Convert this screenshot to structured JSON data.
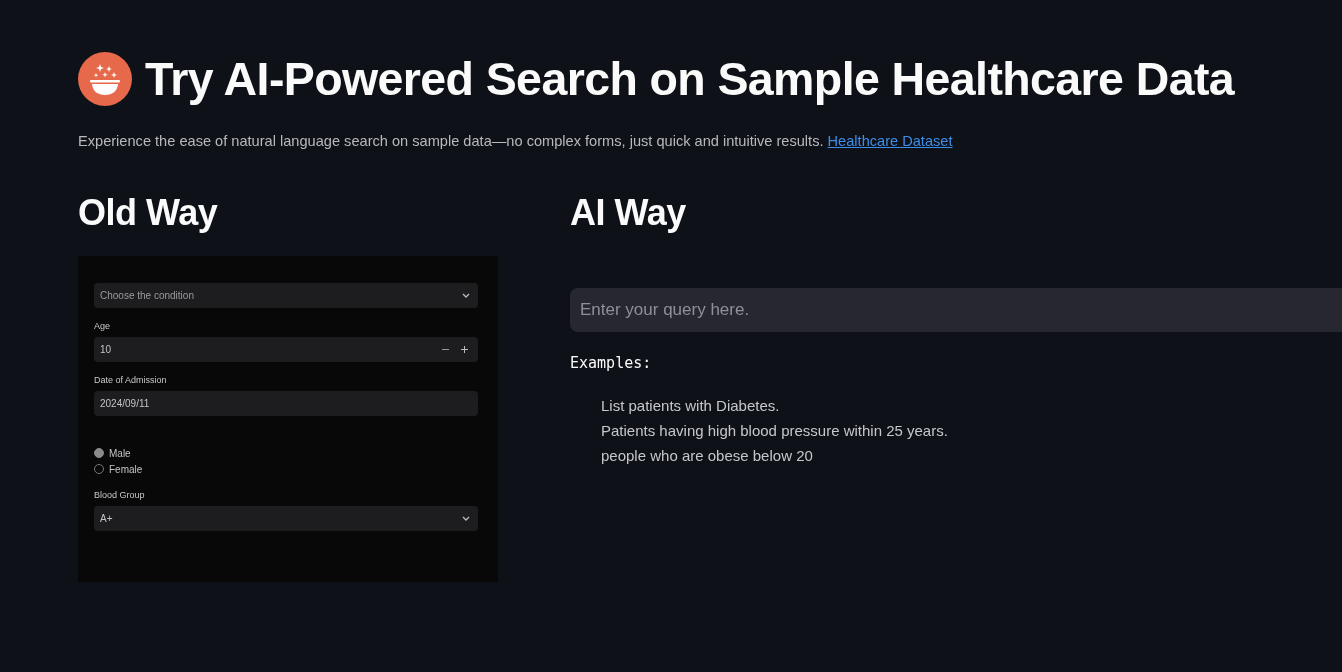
{
  "header": {
    "title": "Try AI-Powered Search on Sample Healthcare Data",
    "subtitle": "Experience the ease of natural language search on sample data—no complex forms, just quick and intuitive results.",
    "link": "Healthcare Dataset"
  },
  "old_way": {
    "heading": "Old Way",
    "form": [
      {
        "kind": "select",
        "placeholder": "Choose the condition"
      },
      {
        "kind": "number",
        "label": "Age",
        "value": "10"
      },
      {
        "kind": "date",
        "label": "Date of Admission",
        "value": "2024/09/11"
      },
      {
        "kind": "radio",
        "options": [
          {
            "label": "Male",
            "selected": true
          },
          {
            "label": "Female",
            "selected": false
          }
        ]
      },
      {
        "kind": "select",
        "label": "Blood Group",
        "value": "A+"
      }
    ]
  },
  "ai_way": {
    "heading": "AI Way",
    "query_field": {
      "placeholder": "Enter your query here."
    },
    "examples_label": "Examples:",
    "examples": [
      "List patients with Diabetes.",
      "Patients having high blood pressure within 25 years.",
      "people who are obese below 20"
    ]
  }
}
